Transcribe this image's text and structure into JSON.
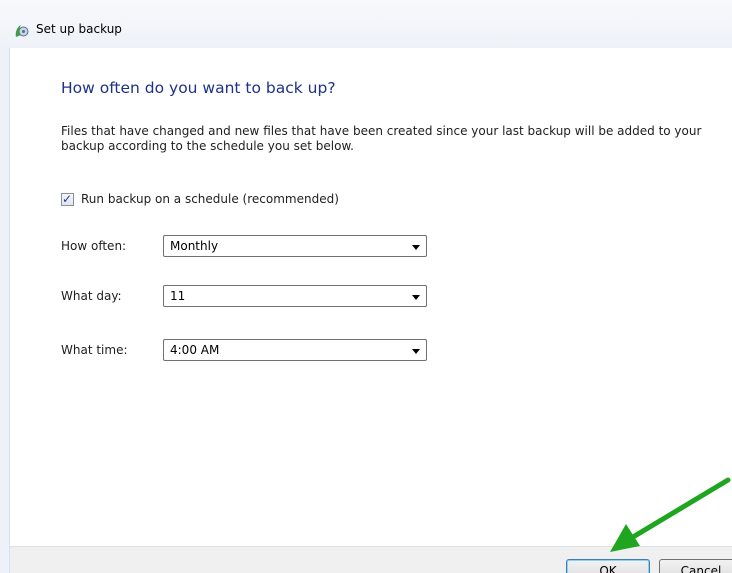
{
  "window": {
    "title": "Set up backup",
    "icon": "backup-icon"
  },
  "main": {
    "heading": "How often do you want to back up?",
    "description": "Files that have changed and new files that have been created since your last backup will be added to your backup according to the schedule you set below.",
    "schedule_checkbox": {
      "label": "Run backup on a schedule (recommended)",
      "checked": true
    },
    "fields": [
      {
        "label": "How often:",
        "value": "Monthly"
      },
      {
        "label": "What day:",
        "value": "11"
      },
      {
        "label": "What time:",
        "value": "4:00 AM"
      }
    ]
  },
  "footer": {
    "ok_label": "OK",
    "cancel_label": "Cancel"
  },
  "annotation": {
    "arrow_color": "#1fa51f",
    "arrow_icon": "pointer-arrow-icon"
  }
}
